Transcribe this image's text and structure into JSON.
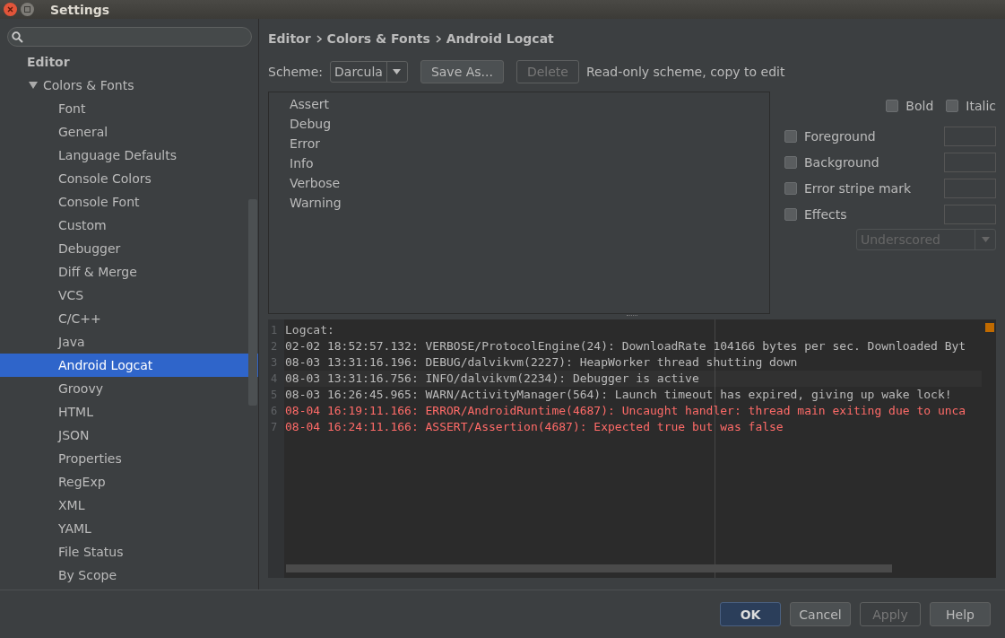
{
  "window": {
    "title": "Settings"
  },
  "sidebar": {
    "section": "Editor",
    "items": [
      {
        "label": "Colors & Fonts",
        "expanded": true,
        "children": [
          {
            "label": "Font",
            "selected": false
          },
          {
            "label": "General",
            "selected": false
          },
          {
            "label": "Language Defaults",
            "selected": false
          },
          {
            "label": "Console Colors",
            "selected": false
          },
          {
            "label": "Console Font",
            "selected": false
          },
          {
            "label": "Custom",
            "selected": false
          },
          {
            "label": "Debugger",
            "selected": false
          },
          {
            "label": "Diff & Merge",
            "selected": false
          },
          {
            "label": "VCS",
            "selected": false
          },
          {
            "label": "C/C++",
            "selected": false
          },
          {
            "label": "Java",
            "selected": false
          },
          {
            "label": "Android Logcat",
            "selected": true
          },
          {
            "label": "Groovy",
            "selected": false
          },
          {
            "label": "HTML",
            "selected": false
          },
          {
            "label": "JSON",
            "selected": false
          },
          {
            "label": "Properties",
            "selected": false
          },
          {
            "label": "RegExp",
            "selected": false
          },
          {
            "label": "XML",
            "selected": false
          },
          {
            "label": "YAML",
            "selected": false
          },
          {
            "label": "File Status",
            "selected": false
          },
          {
            "label": "By Scope",
            "selected": false
          }
        ]
      }
    ]
  },
  "breadcrumb": [
    "Editor",
    "Colors & Fonts",
    "Android Logcat"
  ],
  "scheme": {
    "label": "Scheme:",
    "value": "Darcula",
    "save_as": {
      "label": "Save As...",
      "disabled": false
    },
    "delete": {
      "label": "Delete",
      "disabled": true
    },
    "note": "Read-only scheme, copy to edit"
  },
  "attributes": [
    {
      "label": "Assert",
      "selected": false
    },
    {
      "label": "Debug",
      "selected": false
    },
    {
      "label": "Error",
      "selected": false
    },
    {
      "label": "Info",
      "selected": false
    },
    {
      "label": "Verbose",
      "selected": false
    },
    {
      "label": "Warning",
      "selected": false
    }
  ],
  "font_style": [
    {
      "label": "Bold",
      "checked": false
    },
    {
      "label": "Italic",
      "checked": false
    }
  ],
  "color_options": [
    {
      "label": "Foreground",
      "checked": false
    },
    {
      "label": "Background",
      "checked": false
    },
    {
      "label": "Error stripe mark",
      "checked": false
    },
    {
      "label": "Effects",
      "checked": false
    }
  ],
  "effect_type": {
    "value": "Underscored",
    "disabled": true
  },
  "preview": {
    "lines": [
      {
        "number": "1",
        "text": "Logcat:",
        "color": "#bbbbbb"
      },
      {
        "number": "2",
        "text": "02-02 18:52:57.132: VERBOSE/ProtocolEngine(24): DownloadRate 104166 bytes per sec. Downloaded Byt",
        "color": "#bbbbbb"
      },
      {
        "number": "3",
        "text": "08-03 13:31:16.196: DEBUG/dalvikvm(2227): HeapWorker thread shutting down",
        "color": "#bbbbbb"
      },
      {
        "number": "4",
        "text": "08-03 13:31:16.756: INFO/dalvikvm(2234): Debugger is active",
        "color": "#bbbbbb"
      },
      {
        "number": "5",
        "text": "08-03 16:26:45.965: WARN/ActivityManager(564): Launch timeout has expired, giving up wake lock!",
        "color": "#bbbbbb"
      },
      {
        "number": "6",
        "text": "08-04 16:19:11.166: ERROR/AndroidRuntime(4687): Uncaught handler: thread main exiting due to unca",
        "color": "#ff6b68"
      },
      {
        "number": "7",
        "text": "08-04 16:24:11.166: ASSERT/Assertion(4687): Expected true but was false",
        "color": "#ff6b68"
      }
    ]
  },
  "buttons": [
    {
      "label": "OK",
      "kind": "default",
      "disabled": false
    },
    {
      "label": "Cancel",
      "kind": "normal",
      "disabled": false
    },
    {
      "label": "Apply",
      "kind": "normal",
      "disabled": true
    },
    {
      "label": "Help",
      "kind": "normal",
      "disabled": false
    }
  ]
}
